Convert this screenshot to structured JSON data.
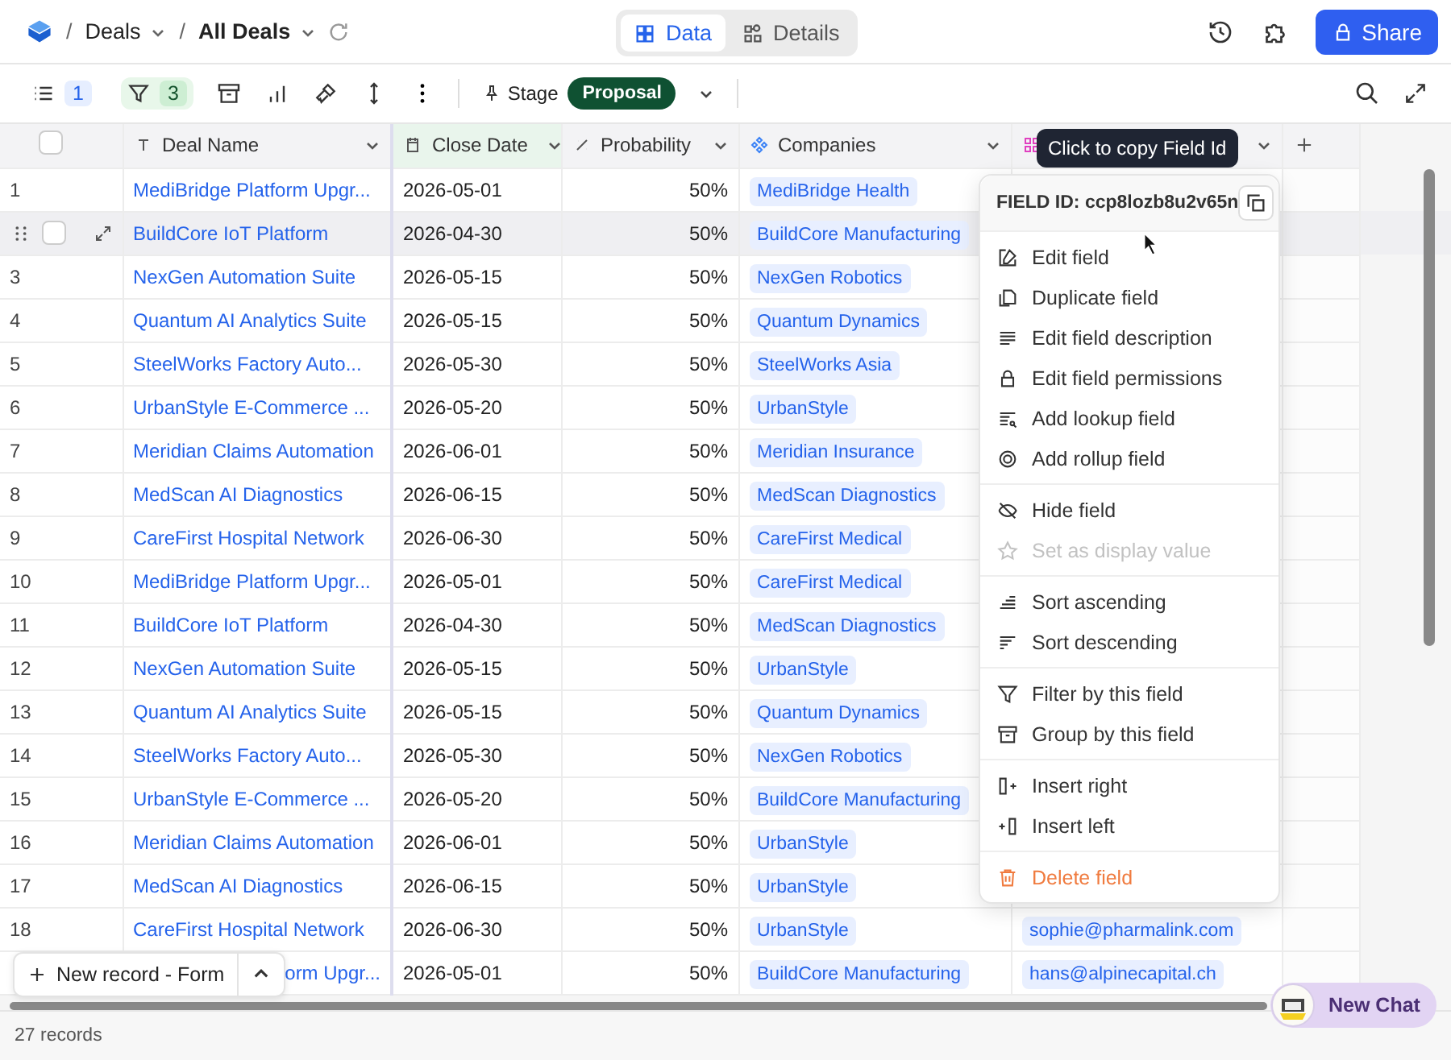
{
  "breadcrumb": [
    {
      "separator": "/",
      "label": "Deals"
    },
    {
      "separator": "/",
      "label": "All Deals"
    }
  ],
  "view_switch": [
    {
      "label": "Data",
      "selected": true
    },
    {
      "label": "Details",
      "selected": false
    }
  ],
  "share_button": "Share",
  "toolbar": {
    "fields_count": "1",
    "filter_count": "3",
    "pin_label": "Stage",
    "pin_value": "Proposal"
  },
  "table": {
    "select_all": {
      "checked": false
    },
    "columns": [
      {
        "label": "Deal Name",
        "kind": "text"
      },
      {
        "label": "Close Date",
        "kind": "date"
      },
      {
        "label": "Probability",
        "kind": "percent"
      },
      {
        "label": "Companies",
        "kind": "link"
      },
      {
        "kind": "email"
      }
    ],
    "rows": [
      {
        "number": "1",
        "deal": "MediBridge Platform Upgr...",
        "date": "2026-05-01",
        "prob": "50%",
        "company": "MediBridge Health",
        "hovered": false
      },
      {
        "deal": "BuildCore IoT Platform",
        "date": "2026-04-30",
        "prob": "50%",
        "company": "BuildCore Manufacturing",
        "hovered": true
      },
      {
        "number": "3",
        "deal": "NexGen Automation Suite",
        "date": "2026-05-15",
        "prob": "50%",
        "company": "NexGen Robotics",
        "hovered": false
      },
      {
        "number": "4",
        "deal": "Quantum AI Analytics Suite",
        "date": "2026-05-15",
        "prob": "50%",
        "company": "Quantum Dynamics",
        "hovered": false
      },
      {
        "number": "5",
        "deal": "SteelWorks Factory Auto...",
        "date": "2026-05-30",
        "prob": "50%",
        "company": "SteelWorks Asia",
        "hovered": false
      },
      {
        "number": "6",
        "deal": "UrbanStyle E-Commerce ...",
        "date": "2026-05-20",
        "prob": "50%",
        "company": "UrbanStyle",
        "hovered": false
      },
      {
        "number": "7",
        "deal": "Meridian Claims Automation",
        "date": "2026-06-01",
        "prob": "50%",
        "company": "Meridian Insurance",
        "hovered": false
      },
      {
        "number": "8",
        "deal": "MedScan AI Diagnostics",
        "date": "2026-06-15",
        "prob": "50%",
        "company": "MedScan Diagnostics",
        "hovered": false
      },
      {
        "number": "9",
        "deal": "CareFirst Hospital Network",
        "date": "2026-06-30",
        "prob": "50%",
        "company": "CareFirst Medical",
        "hovered": false
      },
      {
        "number": "10",
        "deal": "MediBridge Platform Upgr...",
        "date": "2026-05-01",
        "prob": "50%",
        "company": "CareFirst Medical",
        "hovered": false
      },
      {
        "number": "11",
        "deal": "BuildCore IoT Platform",
        "date": "2026-04-30",
        "prob": "50%",
        "company": "MedScan Diagnostics",
        "hovered": false
      },
      {
        "number": "12",
        "deal": "NexGen Automation Suite",
        "date": "2026-05-15",
        "prob": "50%",
        "company": "UrbanStyle",
        "hovered": false
      },
      {
        "number": "13",
        "deal": "Quantum AI Analytics Suite",
        "date": "2026-05-15",
        "prob": "50%",
        "company": "Quantum Dynamics",
        "hovered": false
      },
      {
        "number": "14",
        "deal": "SteelWorks Factory Auto...",
        "date": "2026-05-30",
        "prob": "50%",
        "company": "NexGen Robotics",
        "hovered": false
      },
      {
        "number": "15",
        "deal": "UrbanStyle E-Commerce ...",
        "date": "2026-05-20",
        "prob": "50%",
        "company": "BuildCore Manufacturing",
        "hovered": false
      },
      {
        "number": "16",
        "deal": "Meridian Claims Automation",
        "date": "2026-06-01",
        "prob": "50%",
        "company": "UrbanStyle",
        "hovered": false
      },
      {
        "number": "17",
        "deal": "MedScan AI Diagnostics",
        "date": "2026-06-15",
        "prob": "50%",
        "company": "UrbanStyle",
        "hovered": false
      },
      {
        "number": "18",
        "deal": "CareFirst Hospital Network",
        "date": "2026-06-30",
        "prob": "50%",
        "company": "UrbanStyle",
        "email": "sophie@pharmalink.com",
        "hovered": false
      },
      {
        "deal": "orm Upgr...",
        "date": "2026-05-01",
        "prob": "50%",
        "company": "BuildCore Manufacturing",
        "email": "hans@alpinecapital.ch",
        "hovered": false,
        "kind": "partly-covered"
      }
    ]
  },
  "tooltip": "Click to copy Field Id",
  "field_menu": {
    "field_id": "FIELD ID: ccp8lozb8u2v65n",
    "sections": [
      [
        {
          "label": "Edit field",
          "disabled": false
        },
        {
          "label": "Duplicate field",
          "disabled": false
        },
        {
          "label": "Edit field description",
          "disabled": false
        },
        {
          "label": "Edit field permissions",
          "disabled": false
        },
        {
          "label": "Add lookup field",
          "disabled": false
        },
        {
          "label": "Add rollup field",
          "disabled": false
        }
      ],
      [
        {
          "label": "Hide field",
          "disabled": false
        },
        {
          "label": "Set as display value",
          "disabled": true
        }
      ],
      [
        {
          "label": "Sort ascending",
          "disabled": false
        },
        {
          "label": "Sort descending",
          "disabled": false
        }
      ],
      [
        {
          "label": "Filter by this field",
          "disabled": false
        },
        {
          "label": "Group by this field",
          "disabled": false
        }
      ],
      [
        {
          "label": "Insert right",
          "disabled": false
        },
        {
          "label": "Insert left",
          "disabled": false
        }
      ],
      [
        {
          "label": "Delete field",
          "disabled": false,
          "kind": "danger"
        }
      ]
    ]
  },
  "new_record": {
    "label": "New record - Form"
  },
  "chat_button": "New Chat",
  "status_bar": "27 records"
}
